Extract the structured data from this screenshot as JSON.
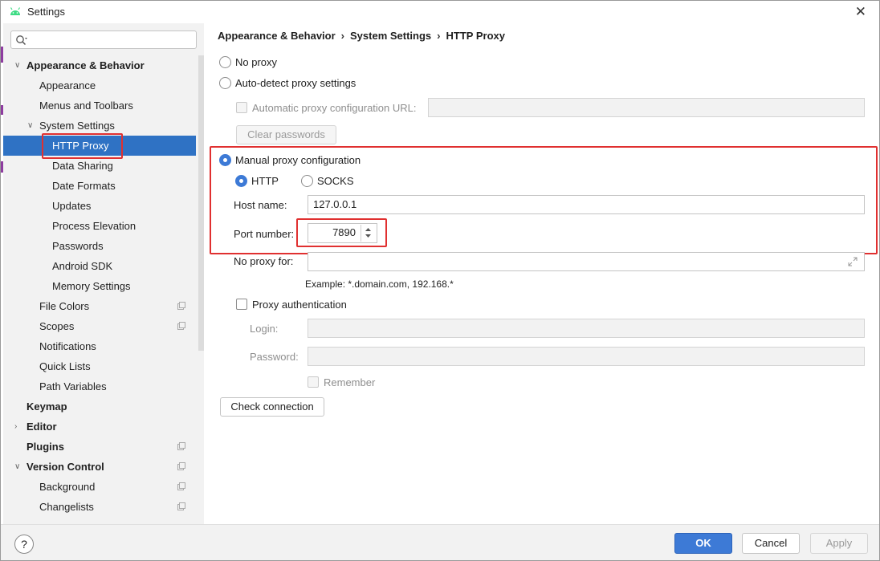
{
  "window": {
    "title": "Settings",
    "close_glyph": "✕"
  },
  "search": {
    "placeholder": ""
  },
  "sidebar": {
    "items": [
      {
        "label": "Appearance & Behavior",
        "bold": true,
        "arrow": "down"
      },
      {
        "label": "Appearance"
      },
      {
        "label": "Menus and Toolbars"
      },
      {
        "label": "System Settings",
        "arrow": "down"
      },
      {
        "label": "HTTP Proxy",
        "selected": true
      },
      {
        "label": "Data Sharing"
      },
      {
        "label": "Date Formats"
      },
      {
        "label": "Updates"
      },
      {
        "label": "Process Elevation"
      },
      {
        "label": "Passwords"
      },
      {
        "label": "Android SDK"
      },
      {
        "label": "Memory Settings"
      },
      {
        "label": "File Colors",
        "project_icon": true
      },
      {
        "label": "Scopes",
        "project_icon": true
      },
      {
        "label": "Notifications"
      },
      {
        "label": "Quick Lists"
      },
      {
        "label": "Path Variables"
      },
      {
        "label": "Keymap",
        "bold": true
      },
      {
        "label": "Editor",
        "bold": true,
        "arrow": "right"
      },
      {
        "label": "Plugins",
        "bold": true,
        "project_icon": true
      },
      {
        "label": "Version Control",
        "bold": true,
        "arrow": "down",
        "project_icon": true
      },
      {
        "label": "Background",
        "project_icon": true
      },
      {
        "label": "Changelists",
        "project_icon": true
      }
    ]
  },
  "breadcrumb": [
    "Appearance & Behavior",
    "System Settings",
    "HTTP Proxy"
  ],
  "breadcrumb_sep": "›",
  "proxy": {
    "no_proxy_label": "No proxy",
    "auto_detect_label": "Auto-detect proxy settings",
    "auto_url_label": "Automatic proxy configuration URL:",
    "auto_url_value": "",
    "clear_passwords_label": "Clear passwords",
    "manual_label": "Manual proxy configuration",
    "http_label": "HTTP",
    "socks_label": "SOCKS",
    "host_label": "Host name:",
    "host_value": "127.0.0.1",
    "port_label": "Port number:",
    "port_value": "7890",
    "no_proxy_for_label": "No proxy for:",
    "no_proxy_for_value": "",
    "example_text": "Example: *.domain.com, 192.168.*",
    "proxy_auth_label": "Proxy authentication",
    "login_label": "Login:",
    "login_value": "",
    "password_label": "Password:",
    "password_value": "",
    "remember_label": "Remember",
    "check_connection_label": "Check connection",
    "selected_mode": "manual",
    "selected_protocol": "http"
  },
  "footer": {
    "help_glyph": "?",
    "ok_label": "OK",
    "cancel_label": "Cancel",
    "apply_label": "Apply"
  },
  "colors": {
    "accent": "#3d7ad6",
    "selection": "#2f72c4",
    "highlight_red": "#e03030",
    "android_green": "#3ddc84"
  }
}
